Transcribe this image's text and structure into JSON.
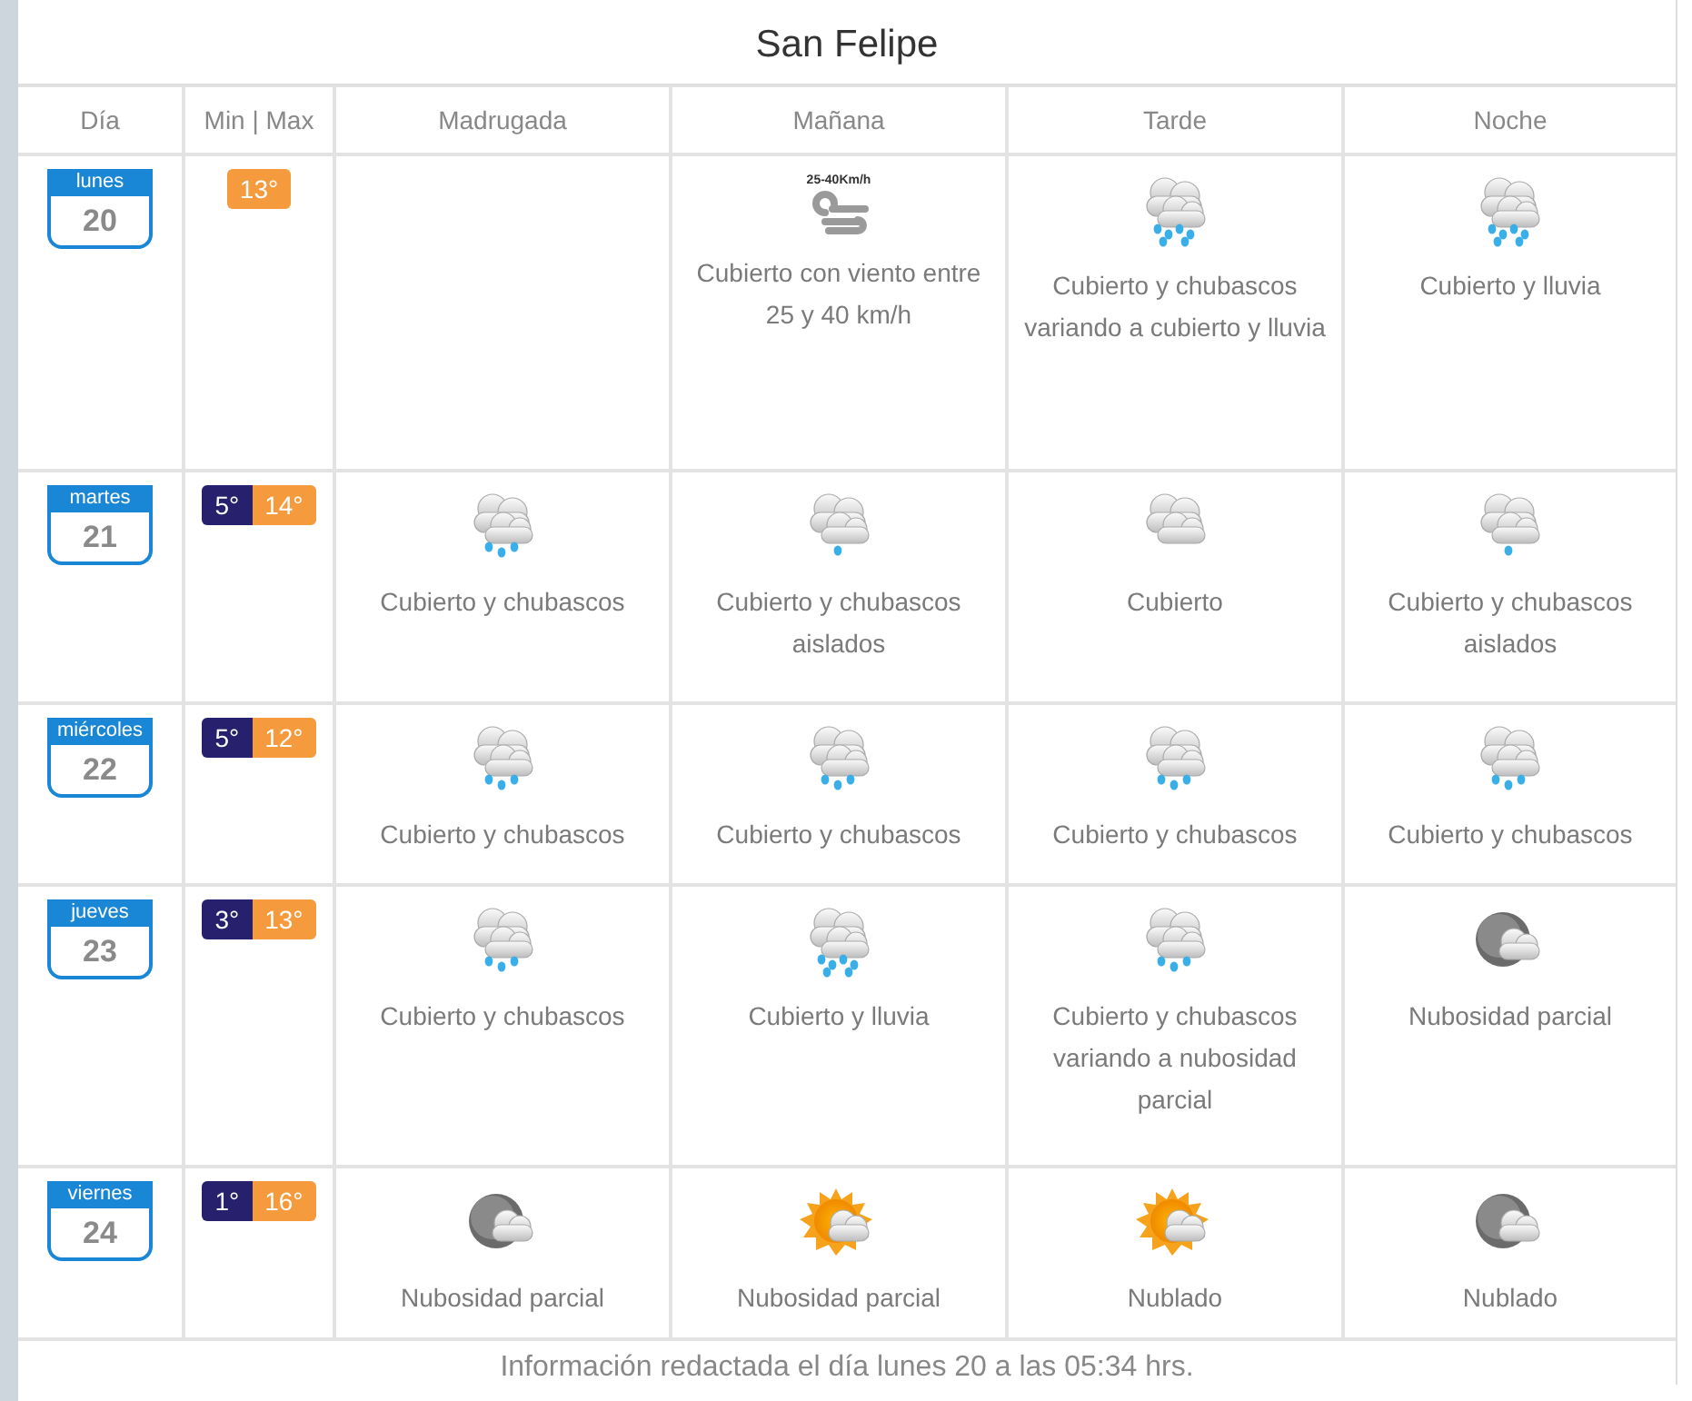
{
  "title": "San Felipe",
  "columns": [
    "Día",
    "Min | Max",
    "Madrugada",
    "Mañana",
    "Tarde",
    "Noche"
  ],
  "days": [
    {
      "weekday": "lunes",
      "day": "20",
      "max": "13°",
      "periods": [
        {
          "kind": "none"
        },
        {
          "kind": "wind",
          "wind_label": "25-40Km/h",
          "text": "Cubierto con viento entre 25 y 40 km/h"
        },
        {
          "kind": "rain",
          "text": "Cubierto y chubascos variando a cubierto y lluvia"
        },
        {
          "kind": "rain",
          "text": "Cubierto y lluvia"
        }
      ]
    },
    {
      "weekday": "martes",
      "day": "21",
      "min": "5°",
      "max": "14°",
      "periods": [
        {
          "kind": "showers",
          "text": "Cubierto y chubascos"
        },
        {
          "kind": "isolated",
          "text": "Cubierto y chubascos aislados"
        },
        {
          "kind": "cloudy",
          "text": "Cubierto"
        },
        {
          "kind": "isolated",
          "text": "Cubierto y chubascos aislados"
        }
      ]
    },
    {
      "weekday": "miércoles",
      "day": "22",
      "min": "5°",
      "max": "12°",
      "periods": [
        {
          "kind": "showers",
          "text": "Cubierto y chubascos"
        },
        {
          "kind": "showers",
          "text": "Cubierto y chubascos"
        },
        {
          "kind": "showers",
          "text": "Cubierto y chubascos"
        },
        {
          "kind": "showers",
          "text": "Cubierto y chubascos"
        }
      ]
    },
    {
      "weekday": "jueves",
      "day": "23",
      "min": "3°",
      "max": "13°",
      "periods": [
        {
          "kind": "showers",
          "text": "Cubierto y chubascos"
        },
        {
          "kind": "rain",
          "text": "Cubierto y lluvia"
        },
        {
          "kind": "showers",
          "text": "Cubierto y chubascos variando a nubosidad parcial"
        },
        {
          "kind": "moon",
          "text": "Nubosidad parcial"
        }
      ]
    },
    {
      "weekday": "viernes",
      "day": "24",
      "min": "1°",
      "max": "16°",
      "periods": [
        {
          "kind": "moon",
          "text": "Nubosidad parcial"
        },
        {
          "kind": "sun",
          "text": "Nubosidad parcial"
        },
        {
          "kind": "sun",
          "text": "Nublado"
        },
        {
          "kind": "moon",
          "text": "Nublado"
        }
      ]
    }
  ],
  "footer": "Información redactada el día lunes 20 a las 05:34 hrs."
}
